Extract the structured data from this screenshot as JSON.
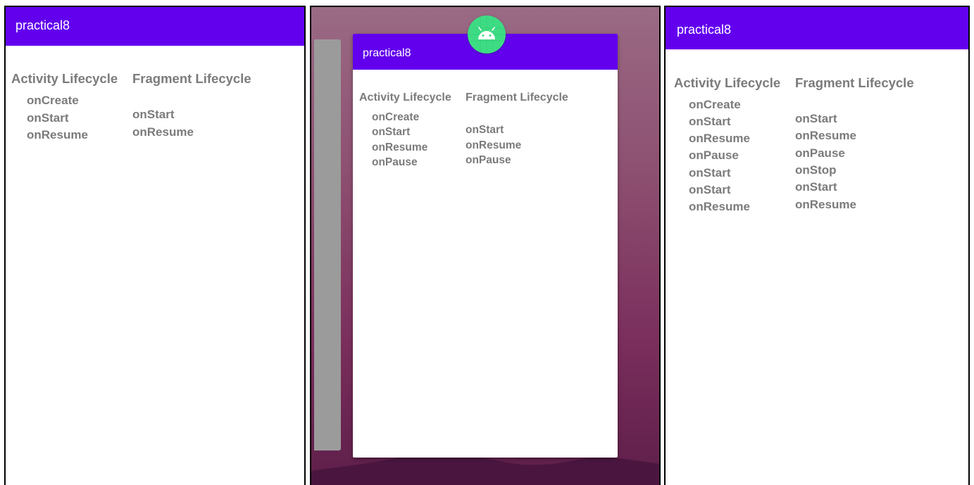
{
  "app_title": "practical8",
  "headers": {
    "activity": "Activity Lifecycle",
    "fragment": "Fragment Lifecycle"
  },
  "screens": [
    {
      "activity": [
        "onCreate",
        "onStart",
        "onResume"
      ],
      "fragment": [
        "onStart",
        "onResume"
      ]
    },
    {
      "activity": [
        "onCreate",
        "onStart",
        "onResume",
        "onPause"
      ],
      "fragment": [
        "onStart",
        "onResume",
        "onPause"
      ]
    },
    {
      "activity": [
        "onCreate",
        "onStart",
        "onResume",
        "onPause",
        "onStart",
        "onStart",
        "onResume"
      ],
      "fragment": [
        "onStart",
        "onResume",
        "onPause",
        "onStop",
        "onStart",
        "onResume"
      ]
    }
  ],
  "icons": {
    "app_icon": "android-icon"
  },
  "colors": {
    "app_bar": "#6200ee",
    "text": "#7b7b7b",
    "app_icon_bg": "#3ddc84"
  }
}
